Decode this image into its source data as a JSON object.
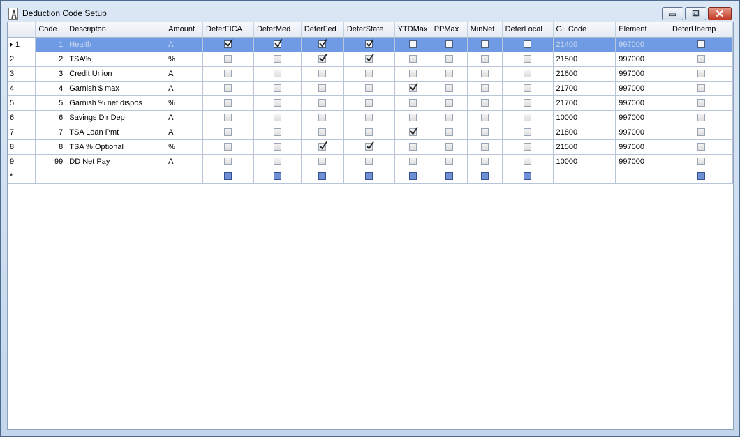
{
  "window": {
    "title": "Deduction Code Setup"
  },
  "columns": [
    "Code",
    "Descripton",
    "Amount",
    "DeferFICA",
    "DeferMed",
    "DeferFed",
    "DeferState",
    "YTDMax",
    "PPMax",
    "MinNet",
    "DeferLocal",
    "GL Code",
    "Element",
    "DeferUnemp"
  ],
  "rows": [
    {
      "rh": "1",
      "code": "1",
      "desc": "Health",
      "amount": "A",
      "fica": true,
      "med": true,
      "fed": true,
      "state": true,
      "ytd": false,
      "ppmax": false,
      "minnet": false,
      "local": false,
      "gl": "21400",
      "element": "997000",
      "unemp": false
    },
    {
      "rh": "2",
      "code": "2",
      "desc": "TSA%",
      "amount": "%",
      "fica": false,
      "med": false,
      "fed": true,
      "state": true,
      "ytd": false,
      "ppmax": false,
      "minnet": false,
      "local": false,
      "gl": "21500",
      "element": "997000",
      "unemp": false
    },
    {
      "rh": "3",
      "code": "3",
      "desc": "Credit Union",
      "amount": "A",
      "fica": false,
      "med": false,
      "fed": false,
      "state": false,
      "ytd": false,
      "ppmax": false,
      "minnet": false,
      "local": false,
      "gl": "21600",
      "element": "997000",
      "unemp": false
    },
    {
      "rh": "4",
      "code": "4",
      "desc": "Garnish $ max",
      "amount": "A",
      "fica": false,
      "med": false,
      "fed": false,
      "state": false,
      "ytd": true,
      "ppmax": false,
      "minnet": false,
      "local": false,
      "gl": "21700",
      "element": "997000",
      "unemp": false
    },
    {
      "rh": "5",
      "code": "5",
      "desc": "Garnish % net dispos",
      "amount": "%",
      "fica": false,
      "med": false,
      "fed": false,
      "state": false,
      "ytd": false,
      "ppmax": false,
      "minnet": false,
      "local": false,
      "gl": "21700",
      "element": "997000",
      "unemp": false
    },
    {
      "rh": "6",
      "code": "6",
      "desc": "Savings Dir Dep",
      "amount": "A",
      "fica": false,
      "med": false,
      "fed": false,
      "state": false,
      "ytd": false,
      "ppmax": false,
      "minnet": false,
      "local": false,
      "gl": "10000",
      "element": "997000",
      "unemp": false
    },
    {
      "rh": "7",
      "code": "7",
      "desc": "TSA Loan Pmt",
      "amount": "A",
      "fica": false,
      "med": false,
      "fed": false,
      "state": false,
      "ytd": true,
      "ppmax": false,
      "minnet": false,
      "local": false,
      "gl": "21800",
      "element": "997000",
      "unemp": false
    },
    {
      "rh": "8",
      "code": "8",
      "desc": "TSA % Optional",
      "amount": "%",
      "fica": false,
      "med": false,
      "fed": true,
      "state": true,
      "ytd": false,
      "ppmax": false,
      "minnet": false,
      "local": false,
      "gl": "21500",
      "element": "997000",
      "unemp": false
    },
    {
      "rh": "9",
      "code": "99",
      "desc": "DD Net Pay",
      "amount": "A",
      "fica": false,
      "med": false,
      "fed": false,
      "state": false,
      "ytd": false,
      "ppmax": false,
      "minnet": false,
      "local": false,
      "gl": "10000",
      "element": "997000",
      "unemp": false
    }
  ],
  "new_row_marker": "*",
  "selected_row_index": 0,
  "colors": {
    "selected_row": "#6f9be5",
    "grid_line": "#b9c6d9",
    "window_frame": "#c4d6ec",
    "close_button": "#c33a24"
  }
}
